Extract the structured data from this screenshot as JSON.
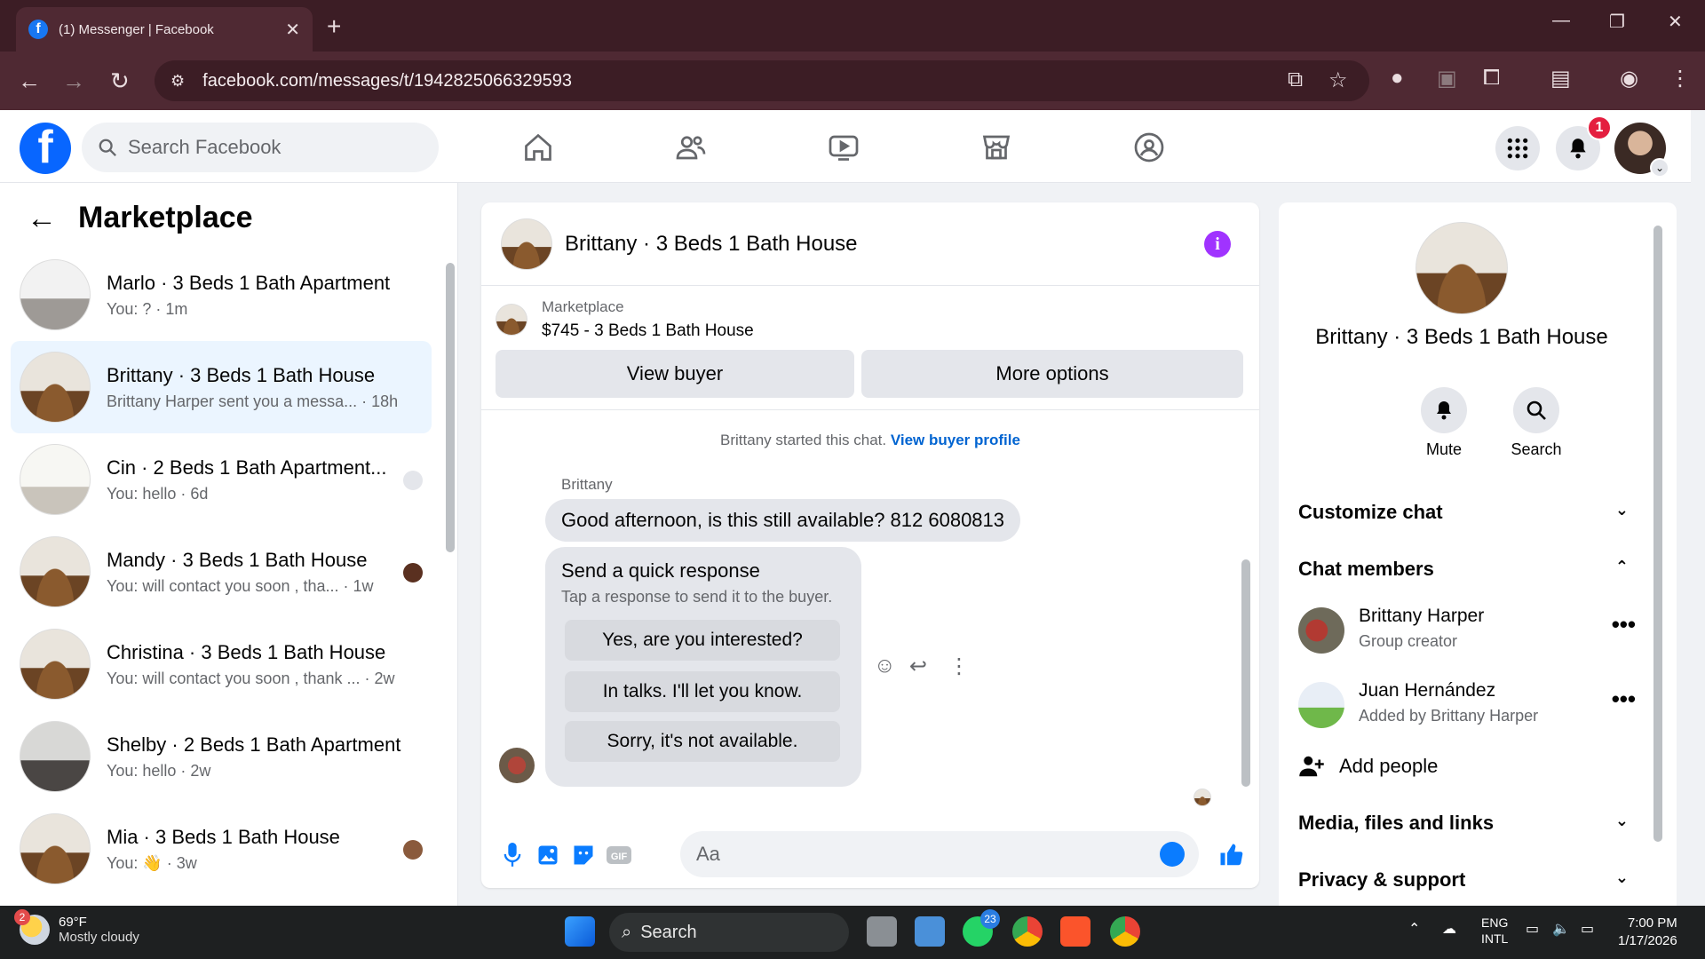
{
  "browser": {
    "tab_title": "(1) Messenger | Facebook",
    "url": "facebook.com/messages/t/1942825066329593"
  },
  "fb": {
    "search_placeholder": "Search Facebook",
    "notif_count": "1"
  },
  "sidebar": {
    "title": "Marketplace",
    "conversations": [
      {
        "name": "Marlo · 3 Beds 1 Bath Apartment",
        "preview": "You: ? · 1m"
      },
      {
        "name": "Brittany · 3 Beds 1 Bath House",
        "preview": "Brittany Harper sent you a messa... · 18h"
      },
      {
        "name": "Cin · 2 Beds 1 Bath Apartment...",
        "preview": "You: hello · 6d"
      },
      {
        "name": "Mandy · 3 Beds 1 Bath House",
        "preview": "You: will contact you soon , tha... · 1w"
      },
      {
        "name": "Christina · 3 Beds 1 Bath House",
        "preview": "You: will contact you soon , thank ... · 2w"
      },
      {
        "name": "Shelby · 2 Beds 1 Bath Apartment",
        "preview": "You: hello · 2w"
      },
      {
        "name": "Mia · 3 Beds 1 Bath House",
        "preview": "You: 👋 · 3w"
      }
    ]
  },
  "chat": {
    "header_name": "Brittany · 3 Beds 1 Bath House",
    "listing_label": "Marketplace",
    "listing_price": "$745 - 3 Beds 1 Bath House",
    "view_buyer": "View buyer",
    "more_options": "More options",
    "started_text": "Brittany started this chat.",
    "view_profile": "View buyer profile",
    "sender": "Brittany",
    "message": "Good afternoon, is this still available? 812 6080813",
    "quick_title": "Send a quick response",
    "quick_sub": "Tap a response to send it to the buyer.",
    "quick_responses": [
      "Yes, are you interested?",
      "In talks. I'll let you know.",
      "Sorry, it's not available."
    ],
    "composer_placeholder": "Aa"
  },
  "details": {
    "name": "Brittany · 3 Beds 1 Bath House",
    "mute": "Mute",
    "search": "Search",
    "customize": "Customize chat",
    "members_title": "Chat members",
    "members": [
      {
        "name": "Brittany Harper",
        "sub": "Group creator"
      },
      {
        "name": "Juan Hernández",
        "sub": "Added by Brittany Harper"
      }
    ],
    "add_people": "Add people",
    "media": "Media, files and links",
    "privacy": "Privacy & support"
  },
  "taskbar": {
    "temp": "69°F",
    "weather": "Mostly cloudy",
    "weather_badge": "2",
    "search": "Search",
    "whatsapp_badge": "23",
    "lang1": "ENG",
    "lang2": "INTL",
    "time": "7:00 PM",
    "date": "1/17/2026"
  },
  "colors": {
    "fb_blue": "#0866ff",
    "active_conv": "#ebf5ff",
    "chrome_bg": "#3c1d25",
    "info_purple": "#a033ff"
  }
}
